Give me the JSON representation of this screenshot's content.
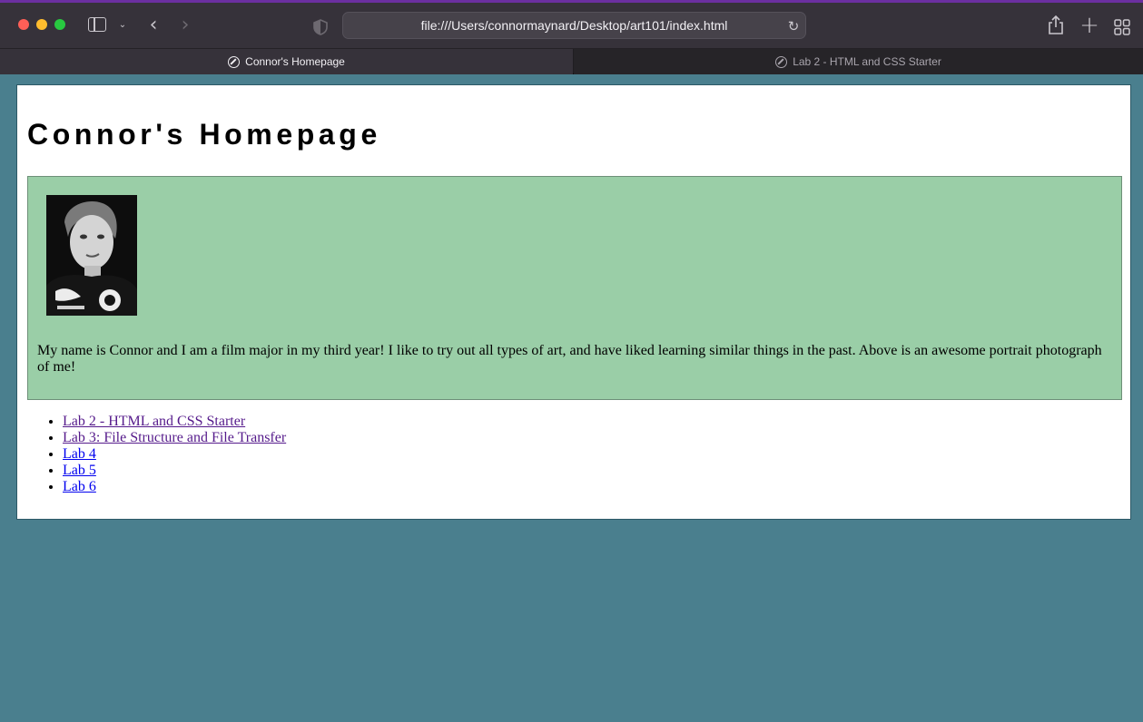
{
  "browser": {
    "url": "file:///Users/connormaynard/Desktop/art101/index.html",
    "tabs": [
      {
        "label": "Connor's Homepage",
        "active": true
      },
      {
        "label": "Lab 2 - HTML and CSS Starter",
        "active": false
      }
    ]
  },
  "page": {
    "title": "Connor's Homepage",
    "intro": "My name is Connor and I am a film major in my third year! I like to try out all types of art, and have liked learning similar things in the past. Above is an awesome portrait photograph of me!",
    "portrait_icon": "portrait-photo",
    "links": [
      {
        "label": "Lab 2 - HTML and CSS Starter",
        "visited": true
      },
      {
        "label": "Lab 3: File Structure and File Transfer",
        "visited": true
      },
      {
        "label": "Lab 4",
        "visited": false
      },
      {
        "label": "Lab 5",
        "visited": false
      },
      {
        "label": "Lab 6",
        "visited": false
      }
    ]
  },
  "colors": {
    "page_background": "#4a7f8e",
    "intro_box": "#9acea7",
    "visited_link": "#551a8b",
    "unvisited_link": "#0000ee"
  }
}
